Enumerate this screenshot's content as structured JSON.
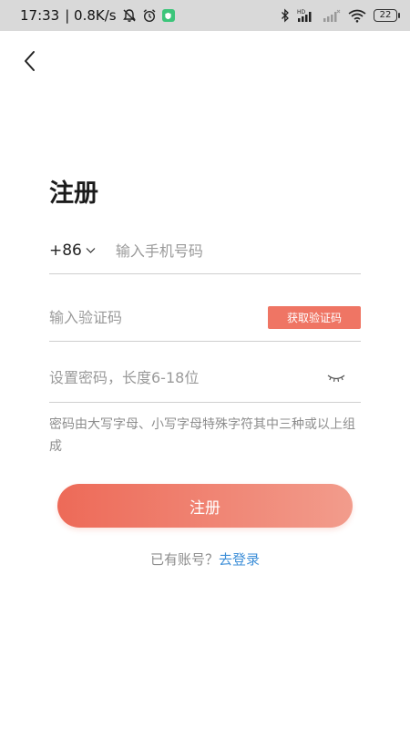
{
  "status_bar": {
    "time": "17:33",
    "network_speed": "| 0.8K/s",
    "battery_level": "22",
    "icons": [
      "mute-icon",
      "alarm-icon",
      "app-notification-icon",
      "bluetooth-icon",
      "hd-signal-icon",
      "signal-icon",
      "wifi-icon",
      "battery-icon"
    ]
  },
  "header": {
    "back_icon": "chevron-left-icon"
  },
  "title": "注册",
  "phone": {
    "country_code": "+86",
    "placeholder": "输入手机号码"
  },
  "code": {
    "placeholder": "输入验证码",
    "get_code_label": "获取验证码"
  },
  "password": {
    "placeholder": "设置密码，长度6-18位",
    "toggle_icon": "eye-closed-icon"
  },
  "hint": "密码由大写字母、小写字母特殊字符其中三种或以上组成",
  "submit_label": "注册",
  "login_prompt": {
    "text": "已有账号？",
    "link": "去登录"
  },
  "colors": {
    "accent": "#ef7564",
    "gradient_start": "#ed6a58",
    "gradient_end": "#f29c8c",
    "link": "#3e8fd8",
    "hint_text": "#8d8d8d"
  }
}
